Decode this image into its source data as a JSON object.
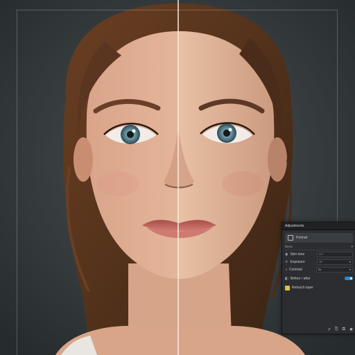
{
  "panel": {
    "title": "Adjustments",
    "preset_label": "Portrait",
    "section_title": "Basic",
    "section_toggle": "▾",
    "rows": [
      {
        "icon": "eye-icon",
        "glyph": "◉",
        "label": "Skin tone",
        "value": "0.7",
        "chev": ""
      },
      {
        "icon": "sun-icon",
        "glyph": "☀",
        "label": "Exposure",
        "value": "0+",
        "chev": "▾"
      },
      {
        "icon": "contrast-icon",
        "glyph": "◑",
        "label": "Contrast",
        "value": "5s",
        "chev": "▾"
      }
    ],
    "toggle_row": {
      "label": "Before / after",
      "on": true
    },
    "layer": {
      "label": "Retouch layer"
    },
    "toolbar": [
      "↗",
      "⎘",
      "⧉",
      "✖"
    ]
  },
  "colors": {
    "background": "#2f3436",
    "panel": "#2b2d30",
    "accent": "#1e8fe0"
  }
}
